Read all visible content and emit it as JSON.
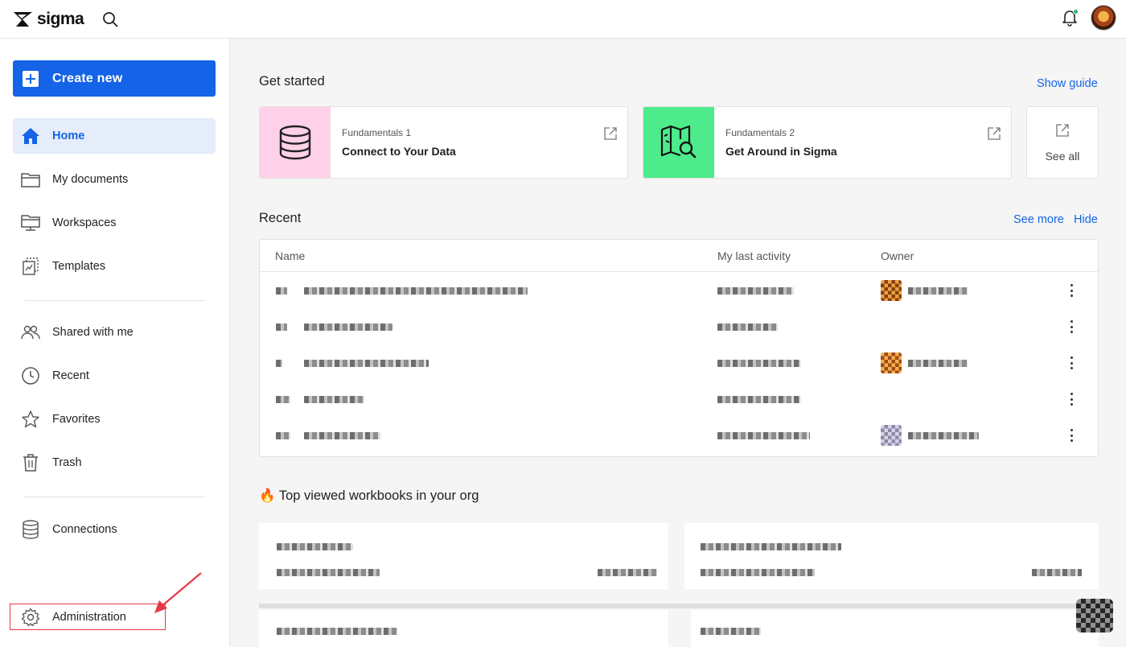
{
  "app": {
    "name": "sigma"
  },
  "sidebar": {
    "create_new": "Create new",
    "items": [
      {
        "label": "Home",
        "icon": "home-icon",
        "active": true
      },
      {
        "label": "My documents",
        "icon": "folder-icon"
      },
      {
        "label": "Workspaces",
        "icon": "workspace-icon"
      },
      {
        "label": "Templates",
        "icon": "templates-icon"
      },
      {
        "label": "Shared with me",
        "icon": "people-icon"
      },
      {
        "label": "Recent",
        "icon": "clock-icon"
      },
      {
        "label": "Favorites",
        "icon": "star-icon"
      },
      {
        "label": "Trash",
        "icon": "trash-icon"
      },
      {
        "label": "Connections",
        "icon": "database-icon"
      },
      {
        "label": "Administration",
        "icon": "gear-icon"
      }
    ]
  },
  "get_started": {
    "title": "Get started",
    "show_guide": "Show guide",
    "cards": [
      {
        "eyebrow": "Fundamentals 1",
        "title": "Connect to Your Data",
        "color": "#ffd1e8"
      },
      {
        "eyebrow": "Fundamentals 2",
        "title": "Get Around in Sigma",
        "color": "#4deb8b"
      }
    ],
    "see_all": "See all"
  },
  "recent": {
    "title": "Recent",
    "see_more": "See more",
    "hide": "Hide",
    "columns": [
      "Name",
      "My last activity",
      "Owner"
    ]
  },
  "top_viewed": {
    "title": "🔥 Top viewed workbooks in your org"
  },
  "colors": {
    "accent": "#1563e6",
    "highlight": "#e63946"
  }
}
